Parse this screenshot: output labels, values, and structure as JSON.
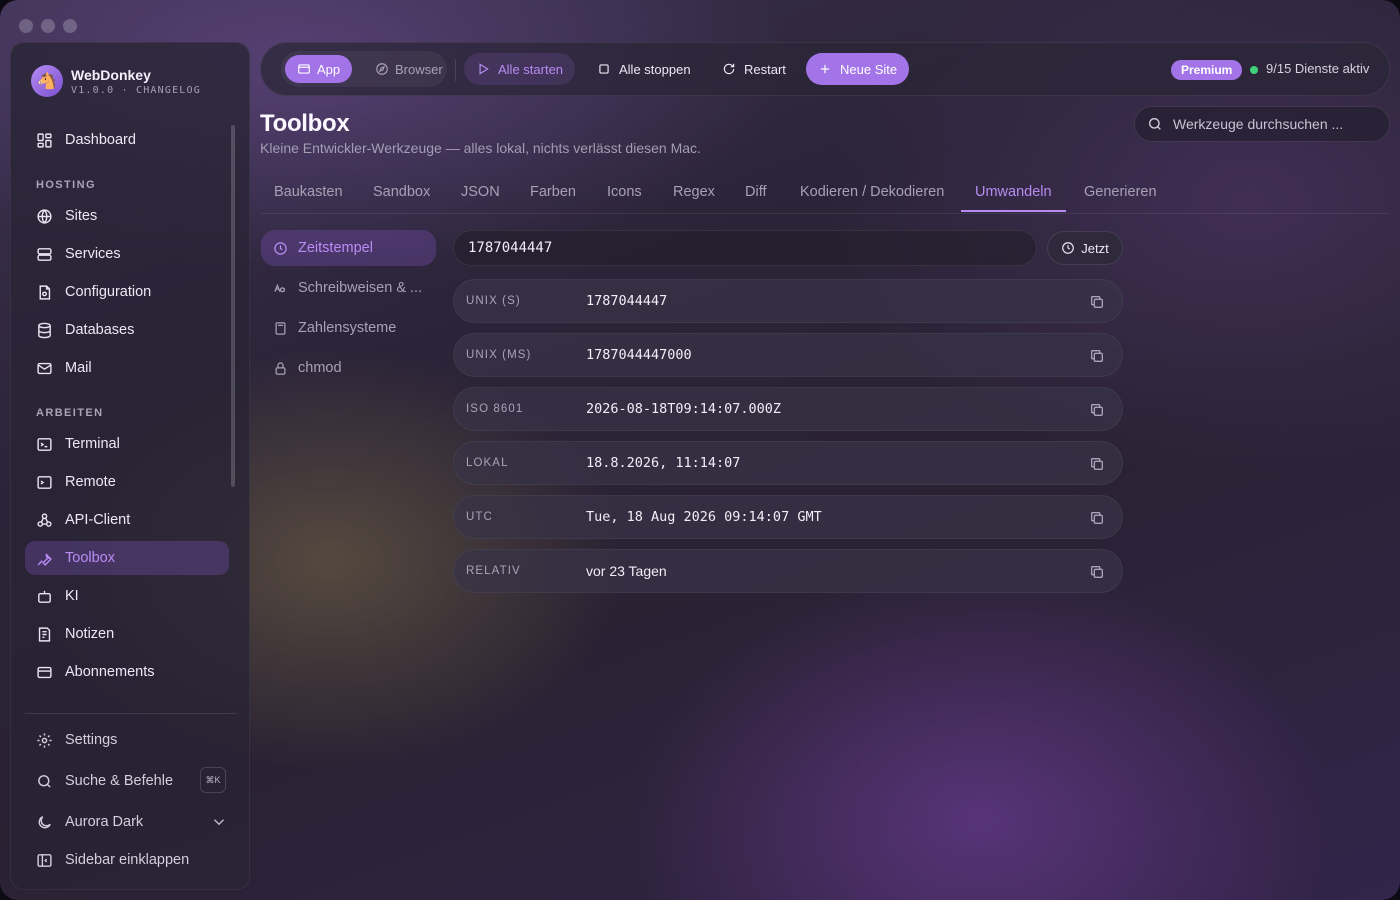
{
  "app": {
    "name": "WebDonkey",
    "version_line": "V1.0.0 · CHANGELOG"
  },
  "sidebar": {
    "dashboard": "Dashboard",
    "section_hosting": "HOSTING",
    "hosting_items": [
      "Sites",
      "Services",
      "Configuration",
      "Databases",
      "Mail"
    ],
    "section_arbeiten": "ARBEITEN",
    "arbeiten_items": [
      "Terminal",
      "Remote",
      "API-Client",
      "Toolbox",
      "KI",
      "Notizen",
      "Abonnements"
    ],
    "active_item": "Toolbox",
    "settings": "Settings",
    "search_commands": "Suche & Befehle",
    "search_shortcut": "⌘K",
    "theme": "Aurora Dark",
    "collapse": "Sidebar einklappen"
  },
  "toolbar": {
    "mode_app": "App",
    "mode_browser": "Browser",
    "start_all": "Alle starten",
    "stop_all": "Alle stoppen",
    "restart": "Restart",
    "new_site": "Neue Site",
    "premium_badge": "Premium",
    "services_status": "9/15 Dienste aktiv"
  },
  "page": {
    "title": "Toolbox",
    "subtitle": "Kleine Entwickler-Werkzeuge — alles lokal, nichts verlässt diesen Mac.",
    "search_placeholder": "Werkzeuge durchsuchen ..."
  },
  "tabs": [
    "Baukasten",
    "Sandbox",
    "JSON",
    "Farben",
    "Icons",
    "Regex",
    "Diff",
    "Kodieren / Dekodieren",
    "Umwandeln",
    "Generieren"
  ],
  "active_tab": "Umwandeln",
  "subnav": [
    "Zeitstempel",
    "Schreibweisen & ...",
    "Zahlensysteme",
    "chmod"
  ],
  "active_subnav": "Zeitstempel",
  "timestamp": {
    "input_value": "1787044447",
    "now_button": "Jetzt",
    "rows": [
      {
        "label": "UNIX (S)",
        "value": "1787044447"
      },
      {
        "label": "UNIX (MS)",
        "value": "1787044447000"
      },
      {
        "label": "ISO 8601",
        "value": "2026-08-18T09:14:07.000Z"
      },
      {
        "label": "LOKAL",
        "value": "18.8.2026, 11:14:07"
      },
      {
        "label": "UTC",
        "value": "Tue, 18 Aug 2026 09:14:07 GMT"
      },
      {
        "label": "RELATIV",
        "value": "vor 23 Tagen"
      }
    ]
  },
  "colors": {
    "accent": "#a374e8",
    "accent_text": "#b68cf2",
    "status_ok": "#3fd27a"
  }
}
